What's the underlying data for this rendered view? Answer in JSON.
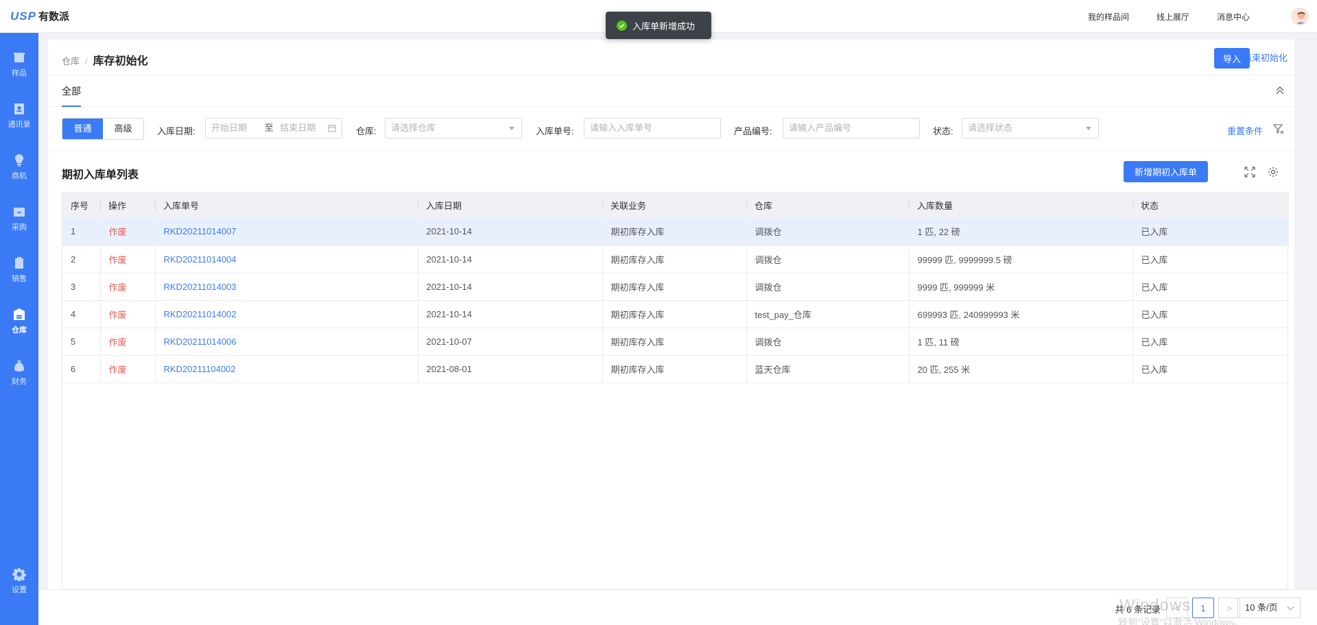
{
  "header": {
    "logo_mark": "USP",
    "logo_text": "有数派",
    "nav": [
      "我的样品间",
      "线上展厅",
      "消息中心"
    ]
  },
  "toast": {
    "message": "入库单新增成功"
  },
  "sidebar": {
    "items": [
      {
        "label": "样品",
        "icon": "box-icon"
      },
      {
        "label": "通讯录",
        "icon": "contacts-icon"
      },
      {
        "label": "商机",
        "icon": "lightbulb-icon"
      },
      {
        "label": "采购",
        "icon": "inbox-icon"
      },
      {
        "label": "销售",
        "icon": "clipboard-check-icon"
      },
      {
        "label": "仓库",
        "icon": "warehouse-icon",
        "active": true
      },
      {
        "label": "财务",
        "icon": "money-bag-icon"
      },
      {
        "label": "设置",
        "icon": "gear-icon"
      }
    ]
  },
  "breadcrumb": {
    "parent": "仓库",
    "separator": "/",
    "current": "库存初始化"
  },
  "actions": {
    "import": "导入",
    "end_init": "结束初始化"
  },
  "tabs": {
    "all": "全部"
  },
  "filters": {
    "mode_normal": "普通",
    "mode_advanced": "高级",
    "date_label": "入库日期:",
    "date_start_placeholder": "开始日期",
    "date_to": "至",
    "date_end_placeholder": "结束日期",
    "warehouse_label": "仓库:",
    "warehouse_placeholder": "请选择仓库",
    "doc_label": "入库单号:",
    "doc_placeholder": "请输入入库单号",
    "product_label": "产品编号:",
    "product_placeholder": "请输入产品编号",
    "status_label": "状态:",
    "status_placeholder": "请选择状态",
    "reset": "重置条件"
  },
  "list": {
    "title": "期初入库单列表",
    "add_button": "新增期初入库单",
    "columns": [
      "序号",
      "操作",
      "入库单号",
      "入库日期",
      "关联业务",
      "仓库",
      "入库数量",
      "状态"
    ],
    "rows": [
      {
        "index": "1",
        "op": "作废",
        "doc_no": "RKD20211014007",
        "date": "2021-10-14",
        "business": "期初库存入库",
        "warehouse": "调拨仓",
        "qty": "1 匹, 22 磅",
        "status": "已入库"
      },
      {
        "index": "2",
        "op": "作废",
        "doc_no": "RKD20211014004",
        "date": "2021-10-14",
        "business": "期初库存入库",
        "warehouse": "调拨仓",
        "qty": "99999 匹, 9999999.5 磅",
        "status": "已入库"
      },
      {
        "index": "3",
        "op": "作废",
        "doc_no": "RKD20211014003",
        "date": "2021-10-14",
        "business": "期初库存入库",
        "warehouse": "调拨仓",
        "qty": "9999 匹, 999999 米",
        "status": "已入库"
      },
      {
        "index": "4",
        "op": "作废",
        "doc_no": "RKD20211014002",
        "date": "2021-10-14",
        "business": "期初库存入库",
        "warehouse": "test_pay_仓库",
        "qty": "699993 匹, 240999993 米",
        "status": "已入库"
      },
      {
        "index": "5",
        "op": "作废",
        "doc_no": "RKD20211014006",
        "date": "2021-10-07",
        "business": "期初库存入库",
        "warehouse": "调拨仓",
        "qty": "1 匹, 11 磅",
        "status": "已入库"
      },
      {
        "index": "6",
        "op": "作废",
        "doc_no": "RKD20211104002",
        "date": "2021-08-01",
        "business": "期初库存入库",
        "warehouse": "蓝天仓库",
        "qty": "20 匹, 255 米",
        "status": "已入库"
      }
    ]
  },
  "pagination": {
    "total": "共 6 条记录",
    "prev": "<",
    "current_page": "1",
    "next": ">",
    "page_size": "10 条/页"
  },
  "watermark": {
    "line1": "Windows",
    "line2": "转到\"设置\"以激活 Windows。"
  },
  "colors": {
    "primary": "#3a7bf5",
    "danger": "#e85a4f",
    "success": "#52c41a"
  }
}
